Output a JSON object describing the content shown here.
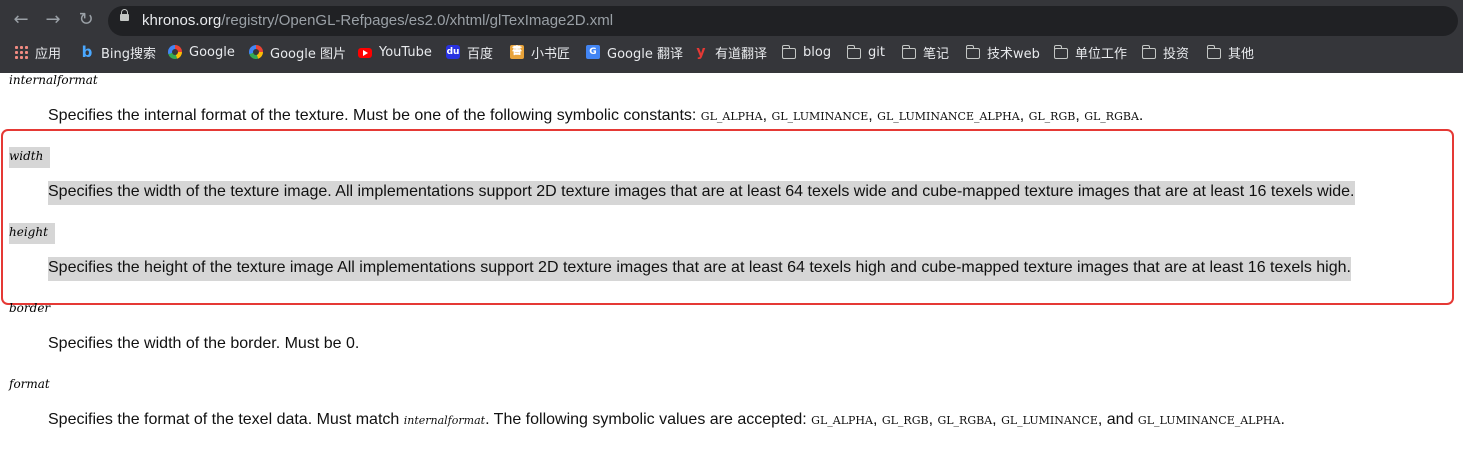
{
  "browser": {
    "url_host": "khronos.org",
    "url_path": "/registry/OpenGL-Refpages/es2.0/xhtml/glTexImage2D.xml",
    "bookmarks": [
      {
        "label": "应用",
        "icon": "apps-grid-icon"
      },
      {
        "label": "Bing搜索",
        "icon": "bing-icon"
      },
      {
        "label": "Google",
        "icon": "google-icon"
      },
      {
        "label": "Google 图片",
        "icon": "google-icon"
      },
      {
        "label": "YouTube",
        "icon": "youtube-icon"
      },
      {
        "label": "百度",
        "icon": "baidu-icon"
      },
      {
        "label": "小书匠",
        "icon": "xiaoshujiang-icon"
      },
      {
        "label": "Google 翻译",
        "icon": "google-translate-icon"
      },
      {
        "label": "有道翻译",
        "icon": "youdao-icon"
      },
      {
        "label": "blog",
        "icon": "folder-icon"
      },
      {
        "label": "git",
        "icon": "folder-icon"
      },
      {
        "label": "笔记",
        "icon": "folder-icon"
      },
      {
        "label": "技术web",
        "icon": "folder-icon"
      },
      {
        "label": "单位工作",
        "icon": "folder-icon"
      },
      {
        "label": "投资",
        "icon": "folder-icon"
      },
      {
        "label": "其他",
        "icon": "folder-icon"
      }
    ]
  },
  "params": {
    "internalformat": {
      "term": "internalformat",
      "text": "Specifies the internal format of the texture. Must be one of the following symbolic constants: ",
      "constants": [
        "GL_ALPHA",
        "GL_LUMINANCE",
        "GL_LUMINANCE_ALPHA",
        "GL_RGB",
        "GL_RGBA"
      ]
    },
    "width": {
      "term": "width",
      "text": "Specifies the width of the texture image. All implementations support 2D texture images that are at least 64 texels wide and cube-mapped texture images that are at least 16 texels wide."
    },
    "height": {
      "term": "height",
      "text": "Specifies the height of the texture image All implementations support 2D texture images that are at least 64 texels high and cube-mapped texture images that are at least 16 texels high."
    },
    "border": {
      "term": "border",
      "text": "Specifies the width of the border. Must be 0."
    },
    "format": {
      "term": "format",
      "text_before": "Specifies the format of the texel data. Must match ",
      "ref": "internalformat",
      "text_after": ". The following symbolic values are accepted: ",
      "constants": [
        "GL_ALPHA",
        "GL_RGB",
        "GL_RGBA",
        "GL_LUMINANCE"
      ],
      "and_word": ", and ",
      "last_constant": "GL_LUMINANCE_ALPHA",
      "end": "."
    }
  },
  "colors": {
    "highlight": "#d6d6d6",
    "annotation_box": "#e53935",
    "chrome_bg": "#35363a"
  }
}
